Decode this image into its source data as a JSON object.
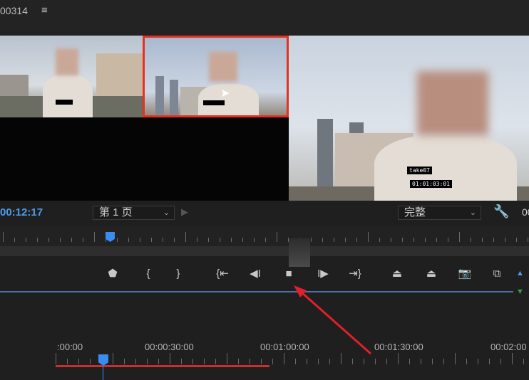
{
  "header": {
    "sequence_name": "00314",
    "menu_icon": "hamburger-icon"
  },
  "source_monitor": {
    "cameras": [
      {
        "label": "",
        "selected": false
      },
      {
        "label": "",
        "selected": true
      }
    ],
    "page_dropdown": {
      "value": "第 1 页"
    }
  },
  "program_monitor": {
    "overlay_label": "take07",
    "overlay_timecode": "01:01:03:01",
    "timecode": "00:12:17",
    "resolution_dropdown": {
      "value": "完整"
    },
    "right_timecode": "00"
  },
  "transport_buttons": [
    {
      "name": "add-marker",
      "glyph": "⬟"
    },
    {
      "name": "mark-in",
      "glyph": "{"
    },
    {
      "name": "mark-out",
      "glyph": "}"
    },
    {
      "name": "go-to-in",
      "glyph": "{⇤"
    },
    {
      "name": "step-back",
      "glyph": "◀I"
    },
    {
      "name": "stop",
      "glyph": "■"
    },
    {
      "name": "step-forward",
      "glyph": "I▶"
    },
    {
      "name": "go-to-out",
      "glyph": "⇥}"
    },
    {
      "name": "lift",
      "glyph": "⏏"
    },
    {
      "name": "extract",
      "glyph": "⏏"
    },
    {
      "name": "export-frame",
      "glyph": "📷"
    },
    {
      "name": "multicam-toggle",
      "glyph": "⧉"
    }
  ],
  "timeline": {
    "ruler_labels": [
      ":00:00",
      "00:00:30:00",
      "00:01:00:00",
      "00:01:30:00",
      "00:02:00"
    ]
  },
  "colors": {
    "accent_blue": "#4d9be6",
    "selection_red": "#e5311f",
    "work_area_red": "#c8302a",
    "annotation_arrow": "#e0202a"
  }
}
